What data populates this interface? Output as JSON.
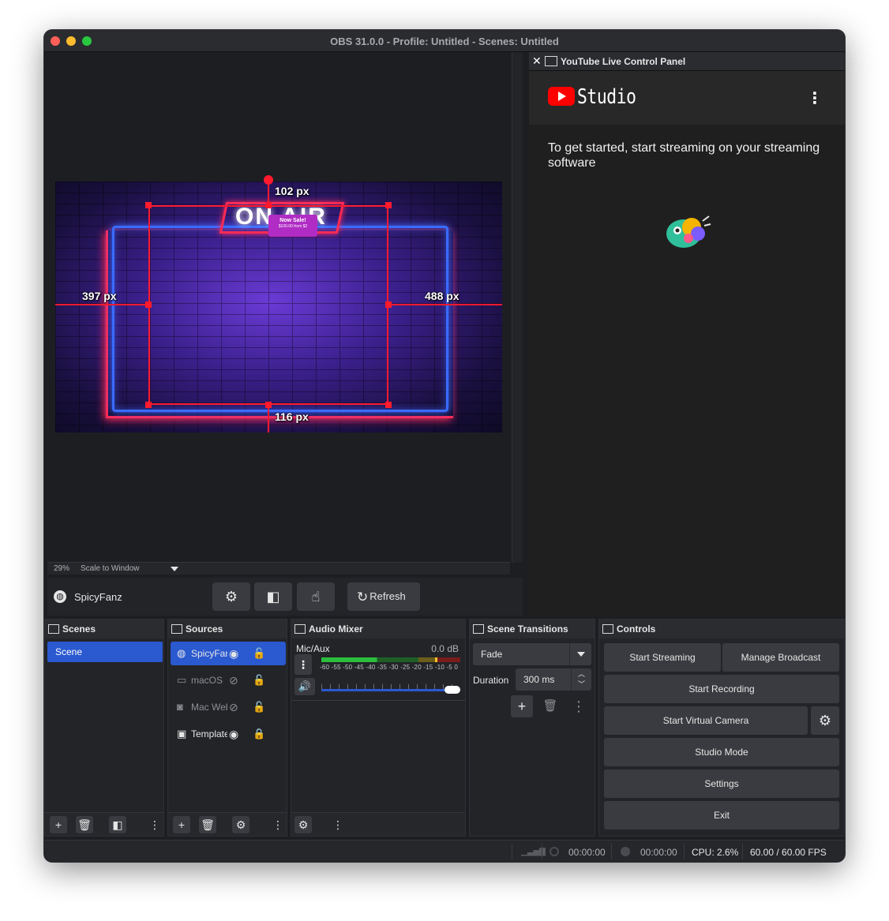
{
  "window": {
    "title": "OBS 31.0.0 - Profile: Untitled - Scenes: Untitled"
  },
  "preview": {
    "zoom": "29%",
    "scale_mode": "Scale to Window",
    "overlay": {
      "onair_text": "ON AIR",
      "sale_badge": "Now Sale!",
      "sale_badge_sub": "$100.00 from $2"
    },
    "guides": {
      "top": "102 px",
      "left": "397 px",
      "right": "488 px",
      "bottom": "116 px"
    }
  },
  "source_toolbar": {
    "source_name": "SpicyFanz",
    "refresh_label": "Refresh"
  },
  "youtube_panel": {
    "dock_title": "YouTube Live Control Panel",
    "brand": "Studio",
    "message": "To get started, start streaming on your streaming software"
  },
  "docks": {
    "scenes": {
      "title": "Scenes",
      "items": [
        "Scene"
      ]
    },
    "sources": {
      "title": "Sources",
      "items": [
        {
          "name": "SpicyFanz",
          "icon": "globe-icon",
          "visible": true,
          "locked": false,
          "selected": true
        },
        {
          "name": "macOS",
          "icon": "monitor-icon",
          "visible": false,
          "locked": false,
          "selected": false
        },
        {
          "name": "Mac Webcam",
          "icon": "camera-icon",
          "visible": false,
          "locked": false,
          "selected": false
        },
        {
          "name": "Template",
          "icon": "image-icon",
          "visible": true,
          "locked": true,
          "selected": false
        }
      ]
    },
    "audio_mixer": {
      "title": "Audio Mixer",
      "channel": "Mic/Aux",
      "level": "0.0 dB",
      "ticks": "-60 -55 -50 -45 -40 -35 -30 -25 -20 -15 -10 -5 0",
      "volume": 1.0
    },
    "scene_transitions": {
      "title": "Scene Transitions",
      "transition": "Fade",
      "duration_label": "Duration",
      "duration": "300 ms"
    },
    "controls": {
      "title": "Controls",
      "start_streaming": "Start Streaming",
      "manage_broadcast": "Manage Broadcast",
      "start_recording": "Start Recording",
      "start_virtual_camera": "Start Virtual Camera",
      "studio_mode": "Studio Mode",
      "settings": "Settings",
      "exit": "Exit"
    }
  },
  "status": {
    "stream_time": "00:00:00",
    "record_time": "00:00:00",
    "cpu": "CPU: 2.6%",
    "fps": "60.00 / 60.00 FPS"
  },
  "colors": {
    "accent": "#2a59d0",
    "selection_red": "#ff1a2e",
    "youtube_red": "#ff0000"
  }
}
